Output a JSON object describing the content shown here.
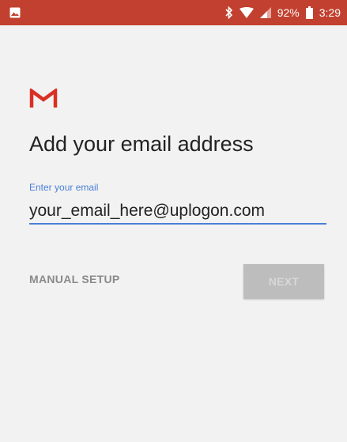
{
  "status_bar": {
    "battery": "92%",
    "time": "3:29",
    "icons": [
      "image-notification-icon",
      "bluetooth-icon",
      "wifi-icon",
      "signal-icon",
      "battery-icon"
    ]
  },
  "colors": {
    "status_bar_bg": "#c2402f",
    "accent": "#4a7fd6",
    "gmail_red": "#d93025",
    "next_bg_disabled": "#bdbdbd"
  },
  "main": {
    "logo_icon": "gmail-logo-icon",
    "title": "Add your email address",
    "email_label": "Enter your email",
    "email_value": "your_email_here@uplogon.com",
    "manual_setup_label": "MANUAL SETUP",
    "next_label": "NEXT"
  }
}
